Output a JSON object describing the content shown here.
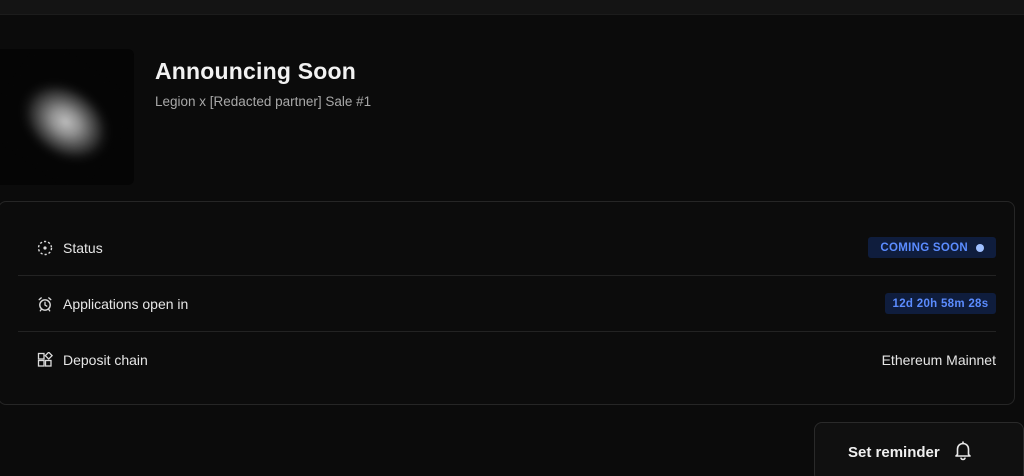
{
  "header": {
    "title": "Announcing Soon",
    "subtitle": "Legion x [Redacted partner] Sale #1"
  },
  "details": {
    "status": {
      "label": "Status",
      "badge": "COMING SOON",
      "icon": "status-dotted-circle-icon"
    },
    "applications": {
      "label": "Applications open in",
      "countdown": "12d 20h 58m 28s",
      "icon": "alarm-clock-icon"
    },
    "deposit_chain": {
      "label": "Deposit chain",
      "value": "Ethereum Mainnet",
      "icon": "blocks-icon"
    }
  },
  "actions": {
    "reminder_label": "Set reminder",
    "reminder_icon": "bell-icon"
  },
  "colors": {
    "background": "#0b0b0b",
    "badge_bg": "#0f1d3d",
    "badge_text": "#5b8cff",
    "badge_dot": "#9fc0ff"
  }
}
